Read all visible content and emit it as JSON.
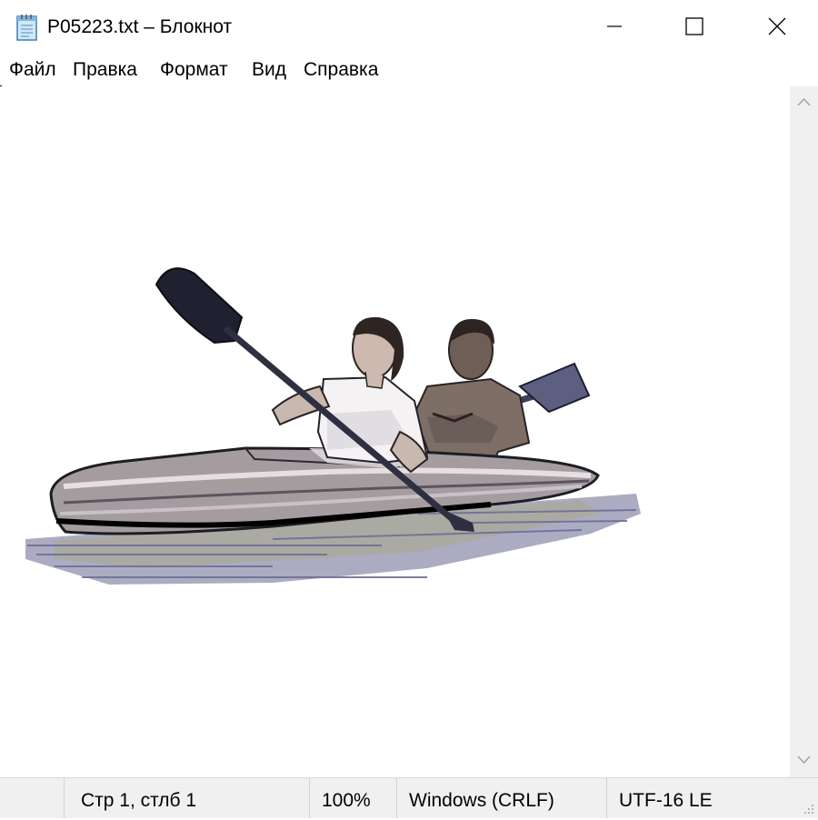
{
  "window": {
    "title": "P05223.txt – Блокнот",
    "icons": {
      "app": "notepad-icon",
      "minimize": "minimize-icon",
      "maximize": "maximize-icon",
      "close": "close-icon"
    }
  },
  "menu": {
    "items": [
      {
        "label": "Файл"
      },
      {
        "label": "Правка"
      },
      {
        "label": "Формат"
      },
      {
        "label": "Вид"
      },
      {
        "label": "Справка"
      }
    ]
  },
  "editor": {
    "content_image": "kayak-illustration"
  },
  "scrollbar": {
    "up_icon": "chevron-up-icon",
    "down_icon": "chevron-down-icon"
  },
  "status": {
    "position": "Стр 1, стлб 1",
    "zoom": "100%",
    "line_endings": "Windows (CRLF)",
    "encoding": "UTF-16 LE"
  },
  "colors": {
    "chrome": "#f0f0f0",
    "window": "#ffffff",
    "text": "#000000"
  }
}
